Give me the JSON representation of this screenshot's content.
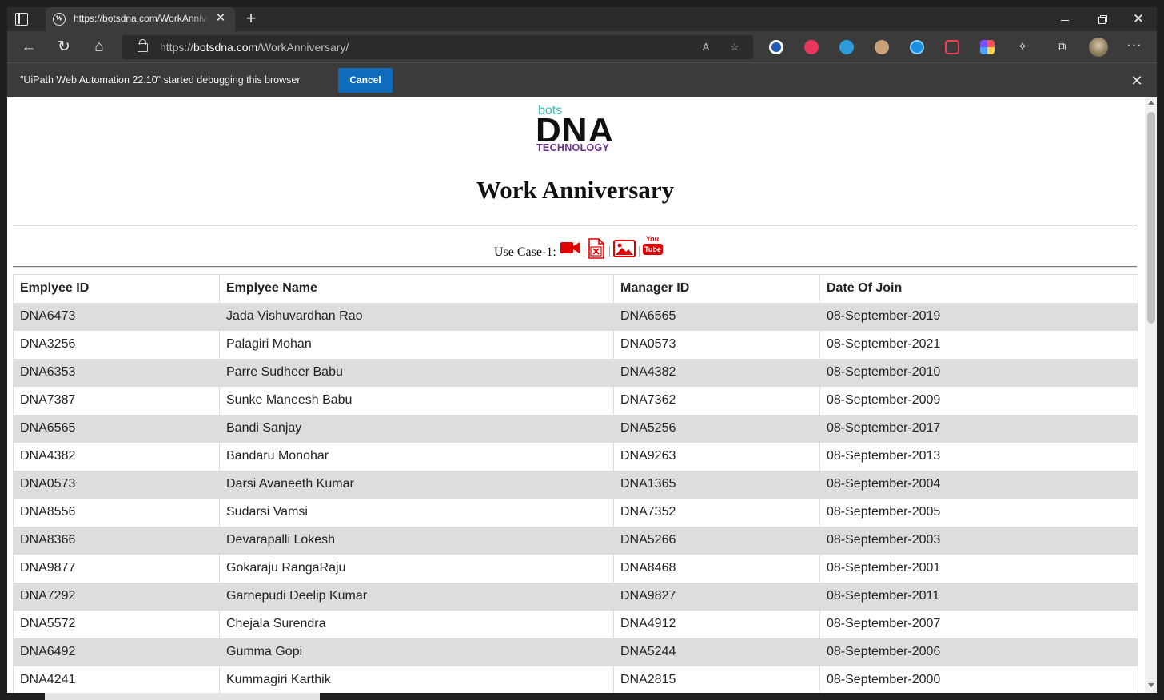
{
  "browser": {
    "tab_title": "https://botsdna.com/WorkAnniversary/",
    "tab_favicon": "W",
    "url_prefix": "https://",
    "url_host": "botsdna.com",
    "url_path": "/WorkAnniversary/",
    "icons": {
      "tab_actions": "tab-actions-icon",
      "back": "←",
      "reload": "↻",
      "home": "⌂",
      "read_aloud": "A",
      "favorites": "☆",
      "extensions": "✧",
      "collections": "⧉",
      "more": "···",
      "close": "✕",
      "new_tab": "+"
    }
  },
  "infobar": {
    "message": "\"UiPath Web Automation 22.10\" started debugging this browser",
    "cancel_label": "Cancel"
  },
  "logo": {
    "top": "bots",
    "main": "DNA",
    "sub": "TECHNOLOGY",
    "colors": {
      "bots": "#3bbfae",
      "dna": "#111111",
      "technology": "#6b2d8f"
    }
  },
  "page": {
    "title": "Work Anniversary",
    "usecase_label": "Use Case-1:",
    "separator": "|",
    "youtube_you": "You",
    "youtube_tube": "Tube"
  },
  "table": {
    "headers": [
      "Emplyee ID",
      "Emplyee Name",
      "Manager ID",
      "Date Of Join"
    ],
    "rows": [
      [
        "DNA6473",
        "Jada Vishuvardhan Rao",
        "DNA6565",
        "08-September-2019"
      ],
      [
        "DNA3256",
        "Palagiri Mohan",
        "DNA0573",
        "08-September-2021"
      ],
      [
        "DNA6353",
        "Parre Sudheer Babu",
        "DNA4382",
        "08-September-2010"
      ],
      [
        "DNA7387",
        "Sunke Maneesh Babu",
        "DNA7362",
        "08-September-2009"
      ],
      [
        "DNA6565",
        "Bandi Sanjay",
        "DNA5256",
        "08-September-2017"
      ],
      [
        "DNA4382",
        "Bandaru Monohar",
        "DNA9263",
        "08-September-2013"
      ],
      [
        "DNA0573",
        "Darsi Avaneeth Kumar",
        "DNA1365",
        "08-September-2004"
      ],
      [
        "DNA8556",
        "Sudarsi Vamsi",
        "DNA7352",
        "08-September-2005"
      ],
      [
        "DNA8366",
        "Devarapalli Lokesh",
        "DNA5266",
        "08-September-2003"
      ],
      [
        "DNA9877",
        "Gokaraju RangaRaju",
        "DNA8468",
        "08-September-2001"
      ],
      [
        "DNA7292",
        "Garnepudi Deelip Kumar",
        "DNA9827",
        "08-September-2011"
      ],
      [
        "DNA5572",
        "Chejala Surendra",
        "DNA4912",
        "08-September-2007"
      ],
      [
        "DNA6492",
        "Gumma Gopi",
        "DNA5244",
        "08-September-2006"
      ],
      [
        "DNA4241",
        "Kummagiri Karthik",
        "DNA2815",
        "08-September-2000"
      ]
    ]
  },
  "colors": {
    "row_shade": "#dddddd",
    "accent_red": "#e00000",
    "cancel_blue": "#0f6cbd"
  }
}
